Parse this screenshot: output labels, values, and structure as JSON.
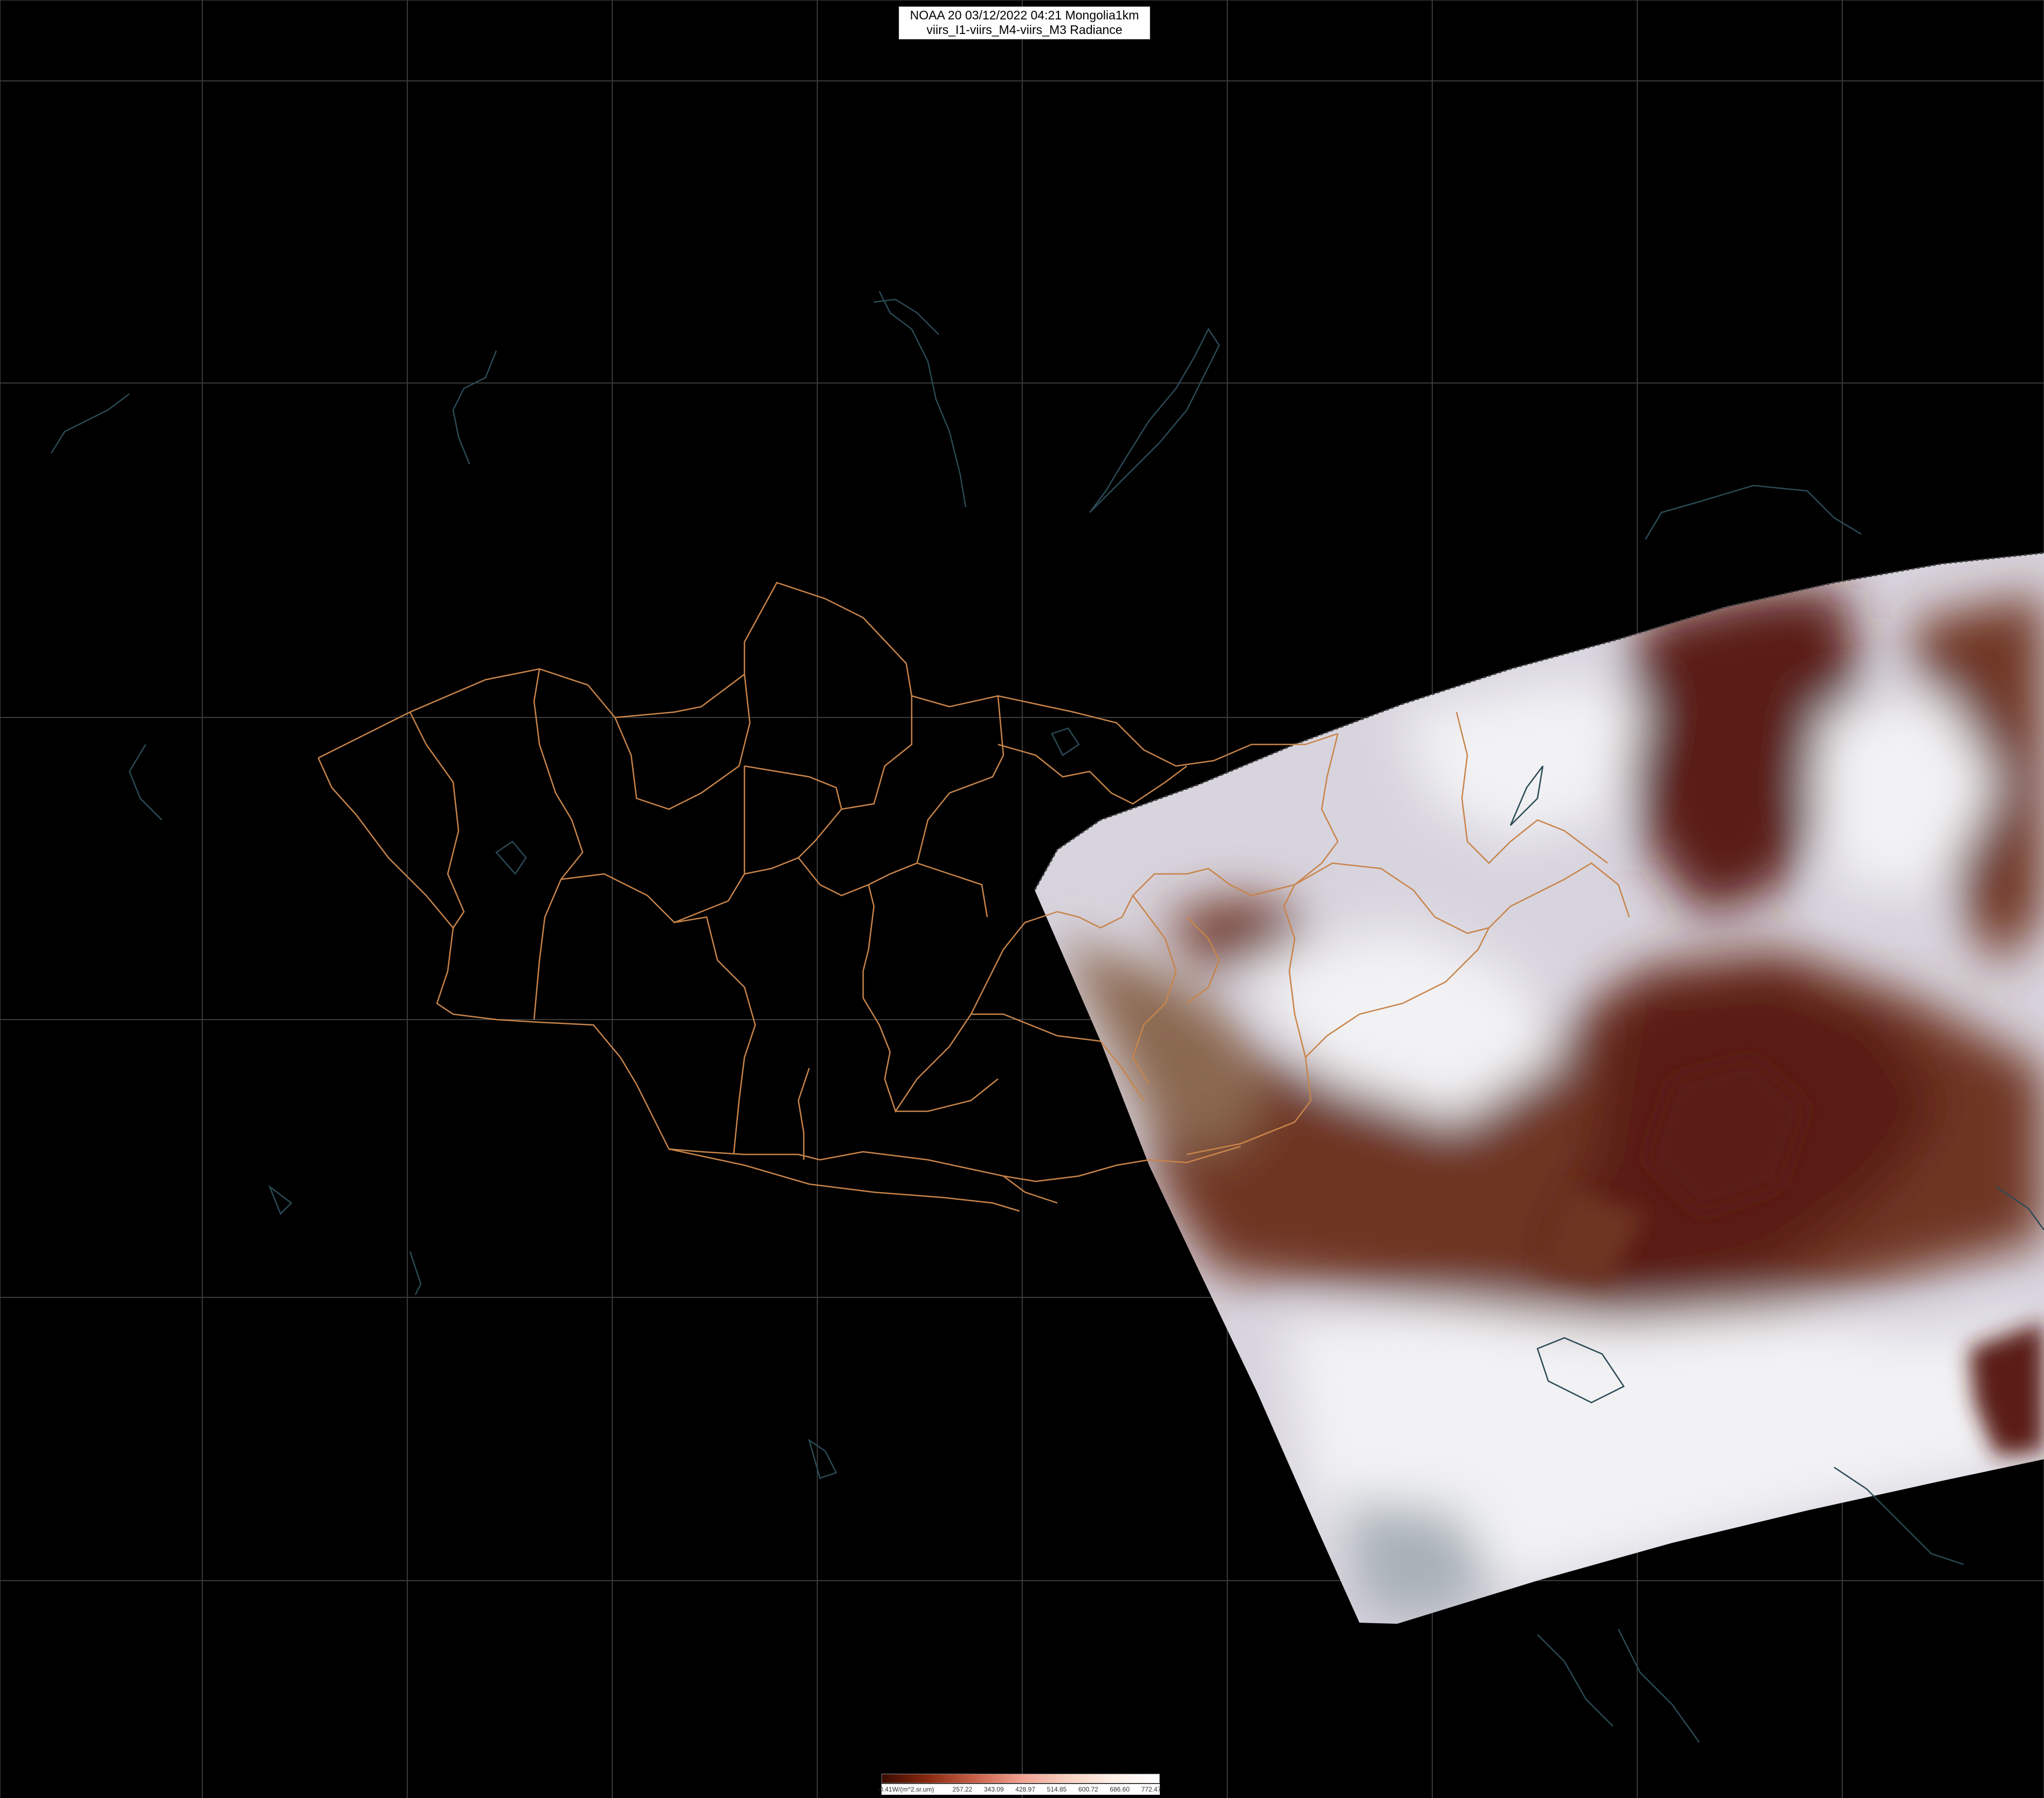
{
  "header": {
    "title_line1": "NOAA 20 03/12/2022 04:21 Mongolia1km",
    "title_line2": "viirs_I1-viirs_M4-viirs_M3 Radiance"
  },
  "colorbar": {
    "unit_label": "-0.41W/(m^2.sr.um)",
    "tick_labels": [
      "257.22",
      "343.09",
      "428.97",
      "514.85",
      "600.72",
      "686.60",
      "772.47"
    ],
    "colors": [
      "#3a0a00",
      "#8a2a10",
      "#c86048",
      "#f0a090",
      "#f8d0c0",
      "#fff0e8",
      "#ffffff"
    ]
  },
  "map": {
    "background_color": "#000000",
    "gridline_color": "#3a3a3a",
    "boundary_color": "#c8844a",
    "coastline_color": "#2a4a55",
    "swath_colors": {
      "ground_dark": "#5a1a14",
      "ground_brown": "#6e3422",
      "snow": "#d8d4de",
      "cloud": "#f2f2f4",
      "haze": "#a8b0b8",
      "tan": "#8a6850"
    }
  }
}
